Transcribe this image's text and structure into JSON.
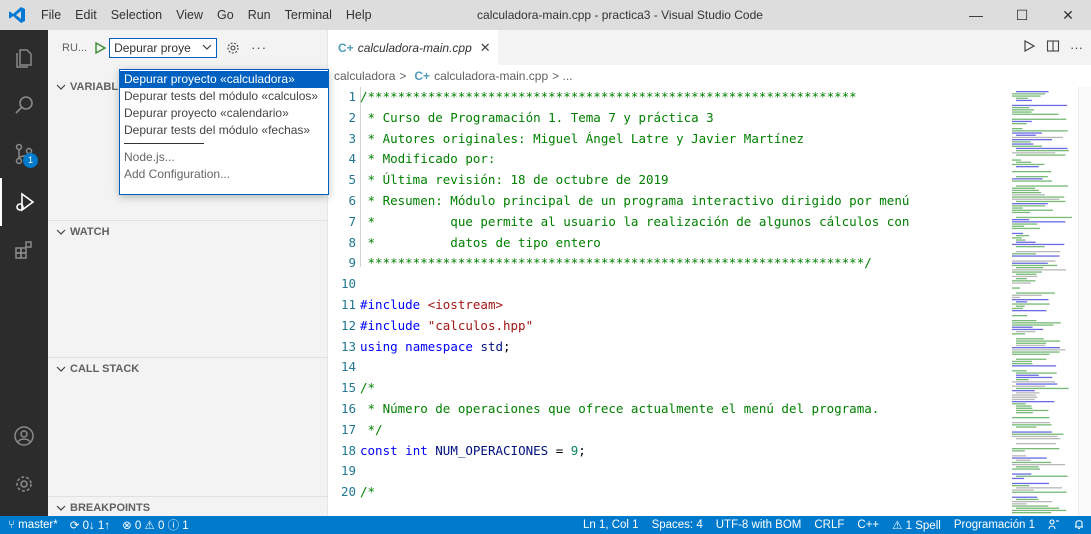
{
  "titlebar": {
    "menu": [
      "File",
      "Edit",
      "Selection",
      "View",
      "Go",
      "Run",
      "Terminal",
      "Help"
    ],
    "window_title": "calculadora-main.cpp - practica3 - Visual Studio Code",
    "minimize": "—",
    "maximize": "☐",
    "close": "✕"
  },
  "sidebar": {
    "run_label": "RU...",
    "config_value": "Depurar proye",
    "more": "···",
    "sections": {
      "variables": "VARIABL",
      "watch": "WATCH",
      "call_stack": "CALL STACK",
      "breakpoints": "BREAKPOINTS"
    }
  },
  "dropdown": {
    "items": [
      "Depurar proyecto «calculadora»",
      "Depurar tests del módulo «calculos»",
      "Depurar proyecto «calendario»",
      "Depurar tests del módulo «fechas»"
    ],
    "extra": [
      "Node.js...",
      "Add Configuration..."
    ]
  },
  "editor": {
    "tab_icon": "C+",
    "tab_name": "calculadora-main.cpp",
    "tab_close": "✕",
    "breadcrumb_folder": "calculadora",
    "breadcrumb_sep": ">",
    "breadcrumb_file": "calculadora-main.cpp",
    "breadcrumb_tail": "> ...",
    "line_numbers": [
      "1",
      "2",
      "3",
      "4",
      "5",
      "6",
      "7",
      "8",
      "9",
      "10",
      "11",
      "12",
      "13",
      "14",
      "15",
      "16",
      "17",
      "18",
      "19",
      "20"
    ],
    "lines": [
      "/*****************************************************************",
      " * Curso de Programación 1. Tema 7 y práctica 3",
      " * Autores originales: Miguel Ángel Latre y Javier Martínez",
      " * Modificado por:",
      " * Última revisión: 18 de octubre de 2019",
      " * Resumen: Módulo principal de un programa interactivo dirigido por menú",
      " *          que permite al usuario la realización de algunos cálculos con",
      " *          datos de tipo entero",
      " ******************************************************************/",
      "",
      "#include <iostream>",
      "#include \"calculos.hpp\"",
      "using namespace std;",
      "",
      "/*",
      " * Número de operaciones que ofrece actualmente el menú del programa.",
      " */",
      "const int NUM_OPERACIONES = 9;",
      "",
      "/*"
    ]
  },
  "statusbar": {
    "branch": "master*",
    "sync": "0↓ 1↑",
    "problems": "⊗ 0 ⚠ 0 ⓘ 1",
    "position": "Ln 1, Col 1",
    "spaces": "Spaces: 4",
    "encoding": "UTF-8 with BOM",
    "eol": "CRLF",
    "language": "C++",
    "spell": "⚠ 1 Spell",
    "profile": "Programación 1"
  },
  "colors": {
    "accent": "#007acc",
    "selection": "#0060c0",
    "activity_bar": "#2c2c2c",
    "comment": "#008000",
    "keyword": "#0000ff",
    "string": "#a31515",
    "number": "#098658",
    "line_number": "#237893"
  }
}
